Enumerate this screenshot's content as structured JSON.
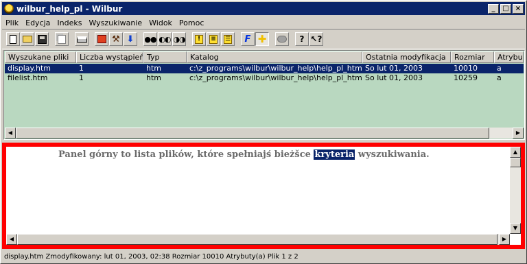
{
  "window": {
    "title": "wilbur_help_pl - Wilbur"
  },
  "titlebar_buttons": {
    "minimize": "_",
    "maximize": "□",
    "close": "×"
  },
  "menu": [
    {
      "label": "Plik"
    },
    {
      "label": "Edycja"
    },
    {
      "label": "Indeks"
    },
    {
      "label": "Wyszukiwanie"
    },
    {
      "label": "Widok"
    },
    {
      "label": "Pomoc"
    }
  ],
  "toolbar_icons": [
    "new-document-icon",
    "open-folder-icon",
    "save-disk-icon",
    "copy-icon",
    "print-icon",
    "red-index-icon",
    "hammer-icon",
    "download-arrow-icon",
    "binoculars-icon",
    "binoculars-prev-icon",
    "binoculars-next-icon",
    "yellow-note-icon",
    "yellow-copy-icon",
    "yellow-list-icon",
    "italic-f-icon",
    "yellow-plus-icon",
    "gray-pill-icon",
    "help-question-icon",
    "context-help-icon"
  ],
  "columns": [
    "Wyszukane pliki",
    "Liczba wystąpień",
    "Typ",
    "Katalog",
    "Ostatnia modyfikacja",
    "Rozmiar",
    "Atrybuty"
  ],
  "rows": [
    {
      "name": "display.htm",
      "count": "1",
      "type": "htm",
      "dir": "c:\\z_programs\\wilbur\\wilbur_help\\help_pl_htm\\",
      "modified": "So lut 01, 2003",
      "size": "10010",
      "attr": "a"
    },
    {
      "name": "filelist.htm",
      "count": "1",
      "type": "htm",
      "dir": "c:\\z_programs\\wilbur\\wilbur_help\\help_pl_htm\\",
      "modified": "So lut 01, 2003",
      "size": "10259",
      "attr": "a"
    }
  ],
  "detail": {
    "before": "Panel górny to lista plików, które spełniajś bieżšce ",
    "highlight": "kryteria",
    "after": " wyszukiwania."
  },
  "status": "display.htm  Zmodyfikowany: lut 01, 2003, 02:38  Rozmiar 10010  Atrybuty(a)  Plik 1 z 2",
  "colors": {
    "list_bg": "#b9d8c0",
    "selection": "#0a246a",
    "frame_highlight": "#ff0000"
  }
}
